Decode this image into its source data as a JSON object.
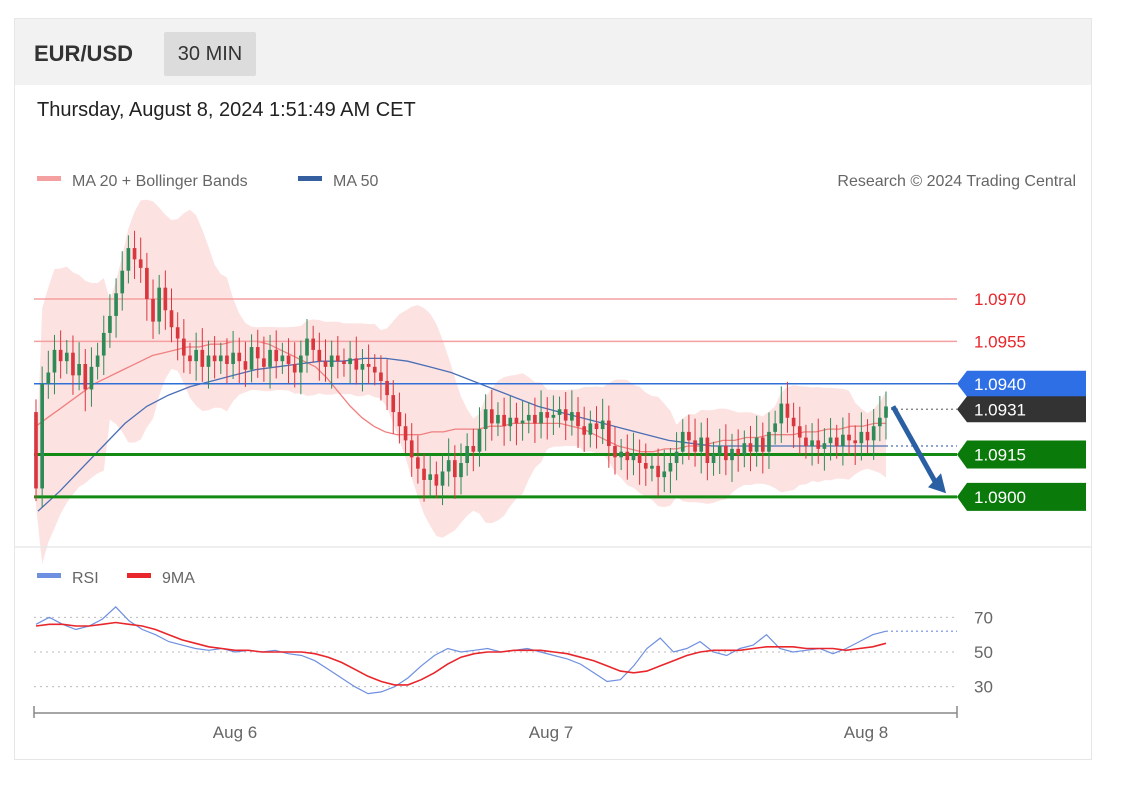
{
  "header": {
    "symbol": "EUR/USD",
    "timeframe": "30 MIN",
    "datetime": "Thursday, August 8, 2024 1:51:49 AM CET"
  },
  "legend": {
    "ma20_bb": "MA 20 + Bollinger Bands",
    "ma50": "MA 50",
    "credit": "Research © 2024 Trading Central",
    "rsi": "RSI",
    "rsi_ma": "9MA"
  },
  "colors": {
    "candle_up": "#2e8b57",
    "candle_down": "#d9363e",
    "bollinger_fill": "#fde2e2",
    "ma20": "#f08080",
    "ma50": "#4a6fb5",
    "resistance": "#f4a0a0",
    "pivot": "#2f6fd6",
    "support": "#138a13",
    "rsi": "#6f8fe0",
    "rsi_ma": "#e8262b"
  },
  "chart_data": [
    {
      "type": "candlestick",
      "name": "price",
      "ylim": [
        1.0883,
        1.1005
      ],
      "x_ticks": [
        "Aug 6",
        "Aug 7",
        "Aug 8"
      ],
      "levels": [
        {
          "label": "1.0970",
          "value": 1.097,
          "kind": "resistance"
        },
        {
          "label": "1.0955",
          "value": 1.0955,
          "kind": "resistance"
        },
        {
          "label": "1.0940",
          "value": 1.094,
          "kind": "pivot"
        },
        {
          "label": "1.0931",
          "value": 1.0931,
          "kind": "last"
        },
        {
          "label": "1.0915",
          "value": 1.0915,
          "kind": "support"
        },
        {
          "label": "1.0900",
          "value": 1.09,
          "kind": "support"
        }
      ],
      "candles_close": [
        1.0903,
        1.094,
        1.0944,
        1.0952,
        1.0948,
        1.0951,
        1.0943,
        1.0947,
        1.0938,
        1.0946,
        1.095,
        1.0958,
        1.0964,
        1.0972,
        1.098,
        1.0988,
        1.0984,
        1.0981,
        1.097,
        1.0962,
        1.0974,
        1.0966,
        1.096,
        1.0956,
        1.095,
        1.0948,
        1.0952,
        1.0946,
        1.095,
        1.0948,
        1.095,
        1.0947,
        1.0951,
        1.0948,
        1.0945,
        1.0953,
        1.0949,
        1.0946,
        1.0952,
        1.0948,
        1.095,
        1.0947,
        1.0944,
        1.095,
        1.0956,
        1.0952,
        1.0948,
        1.0946,
        1.095,
        1.0948,
        1.0947,
        1.0949,
        1.0945,
        1.0947,
        1.0946,
        1.0944,
        1.0941,
        1.0936,
        1.093,
        1.0925,
        1.092,
        1.0914,
        1.091,
        1.0906,
        1.0908,
        1.0904,
        1.0909,
        1.0913,
        1.0907,
        1.0912,
        1.0918,
        1.0916,
        1.0924,
        1.0931,
        1.0926,
        1.0929,
        1.0925,
        1.0928,
        1.0926,
        1.0927,
        1.0929,
        1.0926,
        1.093,
        1.0928,
        1.0929,
        1.0931,
        1.0927,
        1.093,
        1.0925,
        1.0922,
        1.0926,
        1.0924,
        1.0927,
        1.0918,
        1.0914,
        1.0916,
        1.0913,
        1.0915,
        1.0912,
        1.091,
        1.0911,
        1.0907,
        1.0909,
        1.0912,
        1.0916,
        1.0923,
        1.092,
        1.0916,
        1.0921,
        1.0912,
        1.0915,
        1.0918,
        1.0913,
        1.0917,
        1.0915,
        1.0919,
        1.0916,
        1.0921,
        1.0916,
        1.0923,
        1.0926,
        1.0933,
        1.0928,
        1.0925,
        1.0921,
        1.0918,
        1.092,
        1.0917,
        1.0919,
        1.0921,
        1.0918,
        1.0922,
        1.092,
        1.0919,
        1.0923,
        1.092,
        1.0925,
        1.0928,
        1.0932
      ],
      "ma20": [
        1.0925,
        1.0928,
        1.0931,
        1.0934,
        1.0937,
        1.094,
        1.0942,
        1.0944,
        1.0946,
        1.0948,
        1.095,
        1.0951,
        1.0952,
        1.0953,
        1.0953,
        1.0954,
        1.0954,
        1.0955,
        1.0955,
        1.0955,
        1.0954,
        1.0952,
        1.095,
        1.0948,
        1.0946,
        1.0942,
        1.0937,
        1.0932,
        1.0928,
        1.0925,
        1.0923,
        1.0922,
        1.0922,
        1.0922,
        1.0923,
        1.0923,
        1.0924,
        1.0924,
        1.0924,
        1.0925,
        1.0925,
        1.0926,
        1.0926,
        1.0926,
        1.0926,
        1.0926,
        1.0925,
        1.0924,
        1.0922,
        1.092,
        1.0918,
        1.0917,
        1.0916,
        1.0916,
        1.0917,
        1.0917,
        1.0918,
        1.0918,
        1.0919,
        1.092,
        1.092,
        1.0921,
        1.0921,
        1.0922,
        1.0922,
        1.0922,
        1.0923,
        1.0923,
        1.0924,
        1.0924,
        1.0925,
        1.0925,
        1.0926,
        1.0926
      ],
      "ma50": [
        1.0895,
        1.0902,
        1.091,
        1.0918,
        1.0926,
        1.0932,
        1.0936,
        1.0939,
        1.0941,
        1.0943,
        1.0945,
        1.0946,
        1.0947,
        1.0948,
        1.0948,
        1.0949,
        1.0949,
        1.0948,
        1.0946,
        1.0944,
        1.0941,
        1.0938,
        1.0935,
        1.0932,
        1.093,
        1.0928,
        1.0926,
        1.0924,
        1.0922,
        1.092,
        1.0919,
        1.0918,
        1.0918,
        1.0918,
        1.0918,
        1.0918,
        1.0918,
        1.0918,
        1.0918,
        1.0918
      ]
    },
    {
      "type": "line",
      "name": "rsi",
      "ylim": [
        20,
        80
      ],
      "y_ticks": [
        "70",
        "50",
        "30"
      ],
      "series": [
        {
          "name": "RSI",
          "values": [
            66,
            70,
            66,
            63,
            65,
            69,
            76,
            68,
            63,
            60,
            56,
            54,
            52,
            51,
            52,
            50,
            51,
            50,
            51,
            49,
            48,
            45,
            40,
            35,
            30,
            26,
            27,
            30,
            35,
            42,
            48,
            52,
            50,
            51,
            52,
            50,
            51,
            52,
            50,
            48,
            46,
            43,
            38,
            33,
            34,
            42,
            52,
            58,
            50,
            52,
            56,
            50,
            48,
            52,
            54,
            60,
            52,
            50,
            51,
            52,
            49,
            52,
            56,
            60,
            62
          ]
        },
        {
          "name": "9MA",
          "values": [
            65,
            66,
            66,
            65,
            65,
            66,
            67,
            66,
            65,
            63,
            60,
            57,
            55,
            53,
            52,
            51,
            51,
            50,
            50,
            50,
            50,
            49,
            47,
            44,
            40,
            36,
            33,
            31,
            31,
            34,
            38,
            43,
            47,
            49,
            50,
            50,
            51,
            51,
            51,
            50,
            49,
            47,
            45,
            42,
            39,
            38,
            39,
            42,
            45,
            48,
            50,
            51,
            51,
            51,
            52,
            53,
            53,
            53,
            52,
            52,
            52,
            51,
            52,
            53,
            55
          ]
        }
      ]
    }
  ]
}
